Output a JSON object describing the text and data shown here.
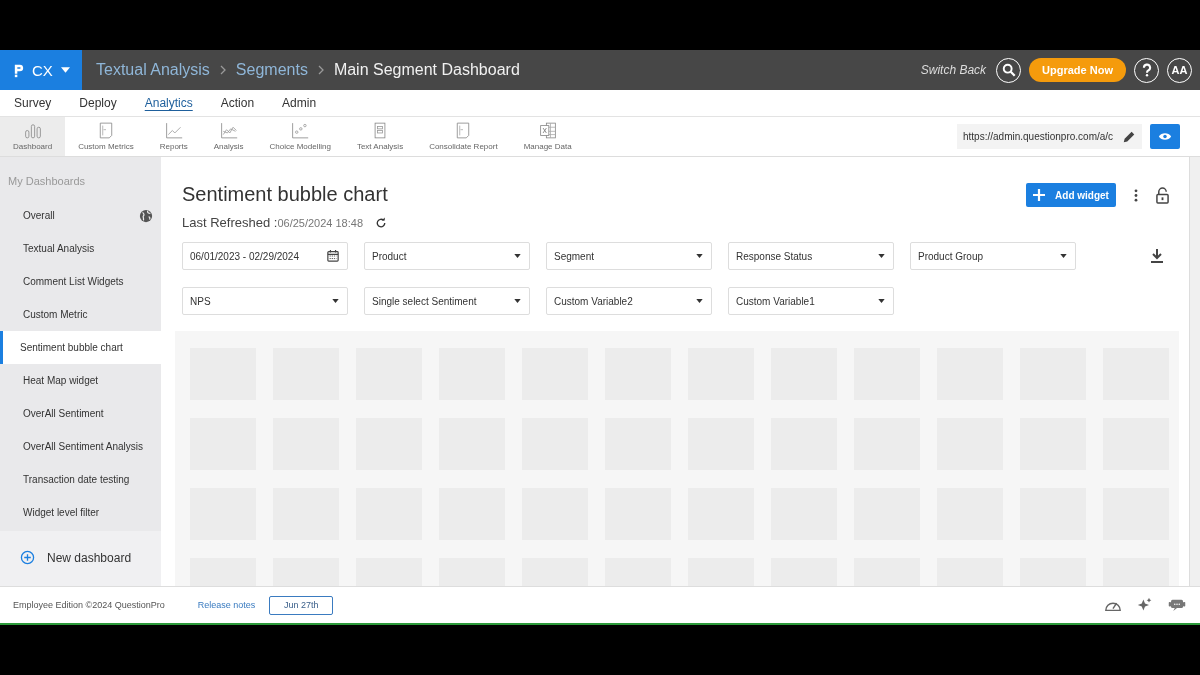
{
  "header": {
    "product": "CX",
    "breadcrumbs": [
      "Textual Analysis",
      "Segments",
      "Main Segment Dashboard"
    ],
    "switch_back": "Switch Back",
    "upgrade": "Upgrade Now",
    "avatar": "AA"
  },
  "nav_tabs": [
    {
      "label": "Survey",
      "selected": false
    },
    {
      "label": "Deploy",
      "selected": false
    },
    {
      "label": "Analytics",
      "selected": true
    },
    {
      "label": "Action",
      "selected": false
    },
    {
      "label": "Admin",
      "selected": false
    }
  ],
  "toolbar": [
    {
      "label": "Dashboard",
      "selected": true
    },
    {
      "label": "Custom Metrics",
      "selected": false
    },
    {
      "label": "Reports",
      "selected": false
    },
    {
      "label": "Analysis",
      "selected": false
    },
    {
      "label": "Choice Modelling",
      "selected": false
    },
    {
      "label": "Text Analysis",
      "selected": false
    },
    {
      "label": "Consolidate Report",
      "selected": false
    },
    {
      "label": "Manage Data",
      "selected": false
    }
  ],
  "url_field": {
    "value": "https://admin.questionpro.com/a/c"
  },
  "sidebar": {
    "heading": "My Dashboards",
    "items": [
      {
        "label": "Overall",
        "selected": false,
        "public": true
      },
      {
        "label": "Textual Analysis",
        "selected": false,
        "public": false
      },
      {
        "label": "Comment List Widgets",
        "selected": false,
        "public": false
      },
      {
        "label": "Custom Metric",
        "selected": false,
        "public": false
      },
      {
        "label": "Sentiment bubble chart",
        "selected": true,
        "public": false
      },
      {
        "label": "Heat Map widget",
        "selected": false,
        "public": false
      },
      {
        "label": "OverAll Sentiment",
        "selected": false,
        "public": false
      },
      {
        "label": "OverAll Sentiment Analysis",
        "selected": false,
        "public": false
      },
      {
        "label": "Transaction date testing",
        "selected": false,
        "public": false
      },
      {
        "label": "Widget level filter",
        "selected": false,
        "public": false
      }
    ],
    "new_dashboard": "New dashboard"
  },
  "dashboard": {
    "title": "Sentiment bubble chart",
    "last_refreshed_label": "Last Refreshed :",
    "last_refreshed_value": "06/25/2024 18:48",
    "add_widget": "Add widget"
  },
  "filters": [
    [
      {
        "kind": "date",
        "value": "06/01/2023 - 02/29/2024"
      },
      {
        "kind": "dropdown",
        "value": "Product"
      },
      {
        "kind": "dropdown",
        "value": "Segment"
      },
      {
        "kind": "dropdown",
        "value": "Response Status"
      },
      {
        "kind": "dropdown",
        "value": "Product Group"
      }
    ],
    [
      {
        "kind": "dropdown",
        "value": "NPS"
      },
      {
        "kind": "dropdown",
        "value": "Single select Sentiment"
      },
      {
        "kind": "dropdown",
        "value": "Custom Variable2"
      },
      {
        "kind": "dropdown",
        "value": "Custom Variable1"
      }
    ]
  ],
  "footer": {
    "edition": "Employee Edition ©2024 QuestionPro",
    "release_notes": "Release notes",
    "release_date": "Jun 27th"
  }
}
